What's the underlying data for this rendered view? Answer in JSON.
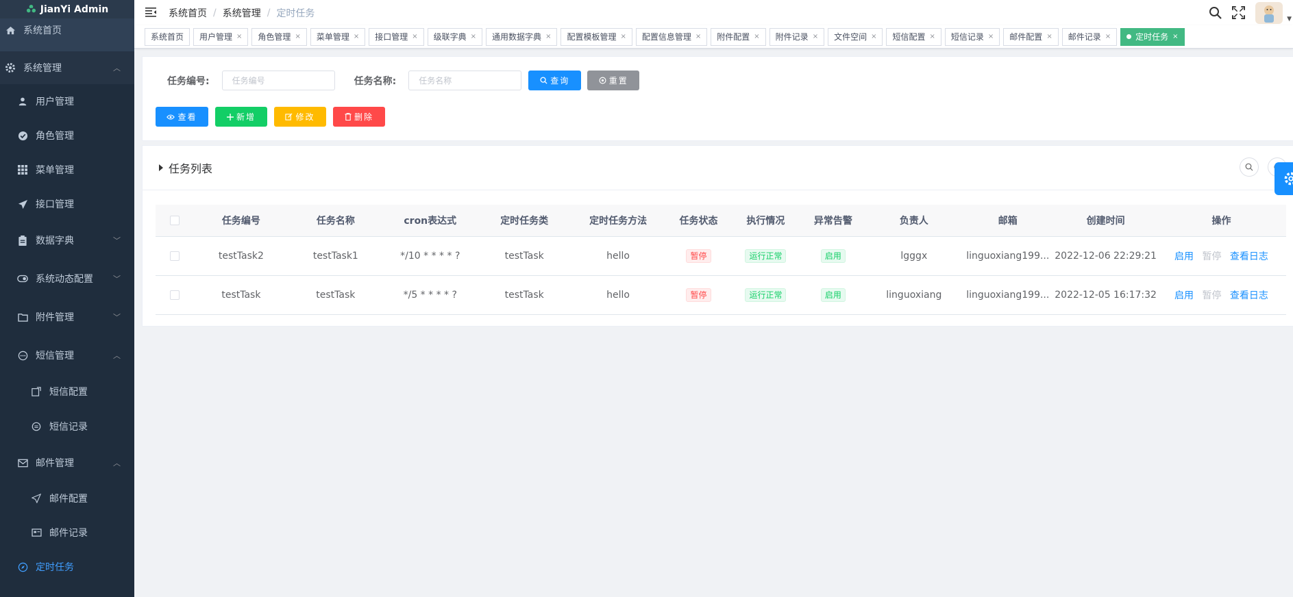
{
  "app": {
    "title": "JianYi Admin"
  },
  "sidebar": {
    "home": "系统首页",
    "system": "系统管理",
    "items": [
      {
        "label": "用户管理"
      },
      {
        "label": "角色管理"
      },
      {
        "label": "菜单管理"
      },
      {
        "label": "接口管理"
      },
      {
        "label": "数据字典"
      },
      {
        "label": "系统动态配置"
      },
      {
        "label": "附件管理"
      },
      {
        "label": "短信管理"
      },
      {
        "label": "短信配置"
      },
      {
        "label": "短信记录"
      },
      {
        "label": "邮件管理"
      },
      {
        "label": "邮件配置"
      },
      {
        "label": "邮件记录"
      },
      {
        "label": "定时任务"
      }
    ]
  },
  "breadcrumb": [
    "系统首页",
    "系统管理",
    "定时任务"
  ],
  "breadcrumb_sep": "/",
  "tags": [
    {
      "label": "系统首页"
    },
    {
      "label": "用户管理"
    },
    {
      "label": "角色管理"
    },
    {
      "label": "菜单管理"
    },
    {
      "label": "接口管理"
    },
    {
      "label": "级联字典"
    },
    {
      "label": "通用数据字典"
    },
    {
      "label": "配置模板管理"
    },
    {
      "label": "配置信息管理"
    },
    {
      "label": "附件配置"
    },
    {
      "label": "附件记录"
    },
    {
      "label": "文件空间"
    },
    {
      "label": "短信配置"
    },
    {
      "label": "短信记录"
    },
    {
      "label": "邮件配置"
    },
    {
      "label": "邮件记录"
    },
    {
      "label": "定时任务"
    }
  ],
  "tag_close": "×",
  "search": {
    "task_no_label": "任务编号:",
    "task_no_placeholder": "任务编号",
    "task_name_label": "任务名称:",
    "task_name_placeholder": "任务名称",
    "query_label": "查询",
    "reset_label": "重置"
  },
  "toolbar": {
    "view_label": "查看",
    "add_label": "新增",
    "edit_label": "修改",
    "delete_label": "删除"
  },
  "table": {
    "title": "任务列表",
    "columns": [
      "任务编号",
      "任务名称",
      "cron表达式",
      "定时任务类",
      "定时任务方法",
      "任务状态",
      "执行情况",
      "异常告警",
      "负责人",
      "邮箱",
      "创建时间",
      "操作"
    ],
    "rows": [
      {
        "task_no": "testTask2",
        "task_name": "testTask1",
        "cron": "*/10 * * * * ?",
        "class": "testTask",
        "method": "hello",
        "status": "暂停",
        "exec": "运行正常",
        "alarm": "启用",
        "owner": "lgggx",
        "email": "linguoxiang199...",
        "created": "2022-12-06 22:29:21"
      },
      {
        "task_no": "testTask",
        "task_name": "testTask",
        "cron": "*/5 * * * * ?",
        "class": "testTask",
        "method": "hello",
        "status": "暂停",
        "exec": "运行正常",
        "alarm": "启用",
        "owner": "linguoxiang",
        "email": "linguoxiang199...",
        "created": "2022-12-05 16:17:32"
      }
    ],
    "actions": {
      "enable": "启用",
      "pause": "暂停",
      "log": "查看日志"
    }
  },
  "colors": {
    "sidebar_bg": "#304156",
    "primary": "#1890ff",
    "active_tag": "#42b983",
    "danger": "#ff4949",
    "success": "#13ce66",
    "warning": "#ffba00"
  }
}
